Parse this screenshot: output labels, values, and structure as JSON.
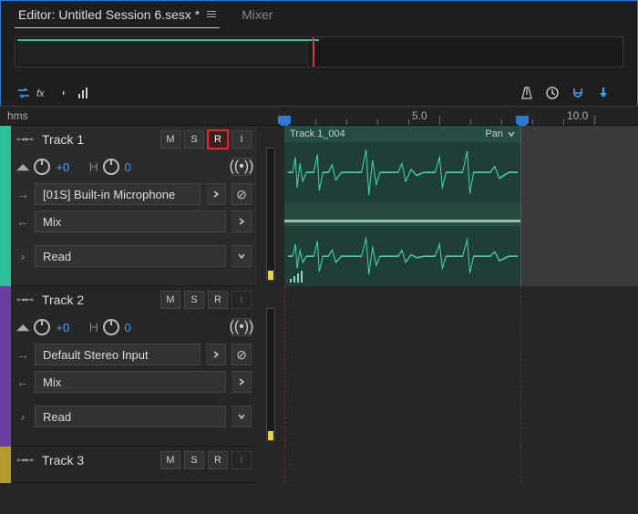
{
  "tabs": {
    "editor_label": "Editor: Untitled Session 6.sesx *",
    "mixer_label": "Mixer"
  },
  "ruler": {
    "unit": "hms",
    "marks": [
      "5.0",
      "10.0"
    ]
  },
  "clip": {
    "name": "Track 1_004",
    "pan_label": "Pan"
  },
  "tracks": [
    {
      "name": "Track 1",
      "vol": "+0",
      "pan": "0",
      "input": "[01S] Built-in Microphone",
      "output": "Mix",
      "automation": "Read",
      "color": "t1",
      "armed": true,
      "panel_dim": false
    },
    {
      "name": "Track 2",
      "vol": "+0",
      "pan": "0",
      "input": "Default Stereo Input",
      "output": "Mix",
      "automation": "Read",
      "color": "t2",
      "armed": false,
      "panel_dim": true
    },
    {
      "name": "Track 3",
      "vol": "",
      "pan": "",
      "input": "",
      "output": "",
      "automation": "",
      "color": "t3",
      "armed": false,
      "panel_dim": true
    }
  ],
  "btn": {
    "M": "M",
    "S": "S",
    "R": "R",
    "I": "I"
  }
}
